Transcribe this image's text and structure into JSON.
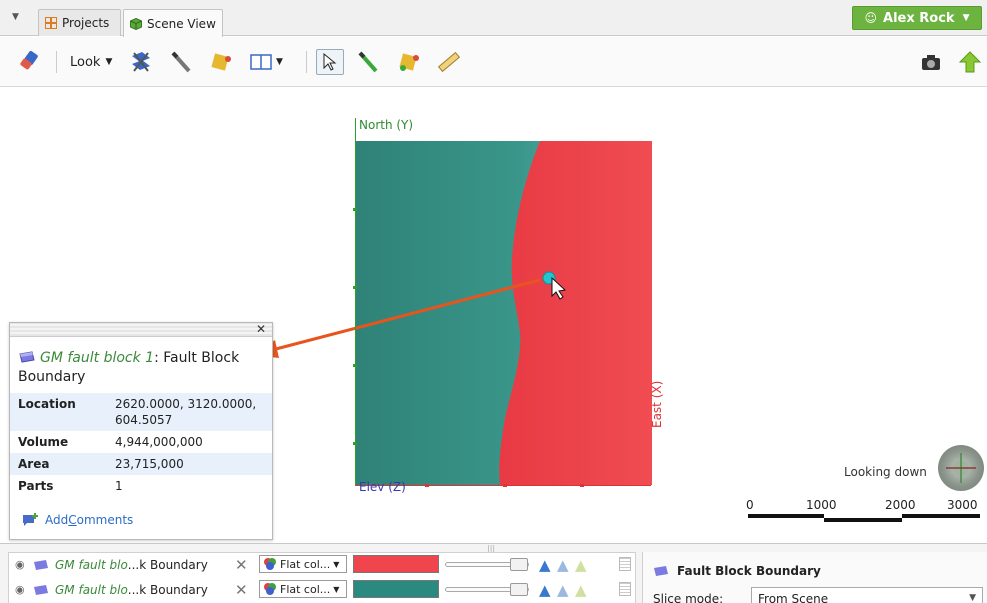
{
  "tabs": [
    {
      "label": "Projects",
      "icon": "projects-grid-icon"
    },
    {
      "label": "Scene View",
      "icon": "scene-cube-icon"
    }
  ],
  "user": {
    "name": "Alex Rock"
  },
  "toolbar": {
    "look_label": "Look"
  },
  "scene": {
    "north_label": "North (Y)",
    "east_label": "East (X)",
    "elev_label": "Elev (Z)",
    "compass_label": "Looking down",
    "scale_ticks": [
      "0",
      "1000",
      "2000",
      "3000"
    ],
    "colors": {
      "left": "#35897a",
      "right": "#f0454d",
      "pick": "#22c4d0",
      "arrow": "#e8541e"
    }
  },
  "popup": {
    "object_name": "GM fault block 1",
    "object_type": ": Fault Block",
    "object_type_2": "Boundary",
    "rows": [
      {
        "key": "Location",
        "value": "2620.0000, 3120.0000, 604.5057"
      },
      {
        "key": "Volume",
        "value": "4,944,000,000"
      },
      {
        "key": "Area",
        "value": "23,715,000"
      },
      {
        "key": "Parts",
        "value": "1"
      }
    ],
    "add_comments_prefix": "Add ",
    "add_comments_underlined": "C",
    "add_comments_rest": "omments"
  },
  "shapes": [
    {
      "name_italic": "GM fault blo",
      "name_rest": "...k Boundary",
      "color_mode": "Flat col...",
      "color": "#f0454d"
    },
    {
      "name_italic": "GM fault blo",
      "name_rest": "...k Boundary",
      "color_mode": "Flat col...",
      "color": "#2a8a80"
    }
  ],
  "properties": {
    "title": "Fault Block Boundary",
    "slice_mode_label": "Slice mode:",
    "slice_mode_value": "From Scene"
  }
}
